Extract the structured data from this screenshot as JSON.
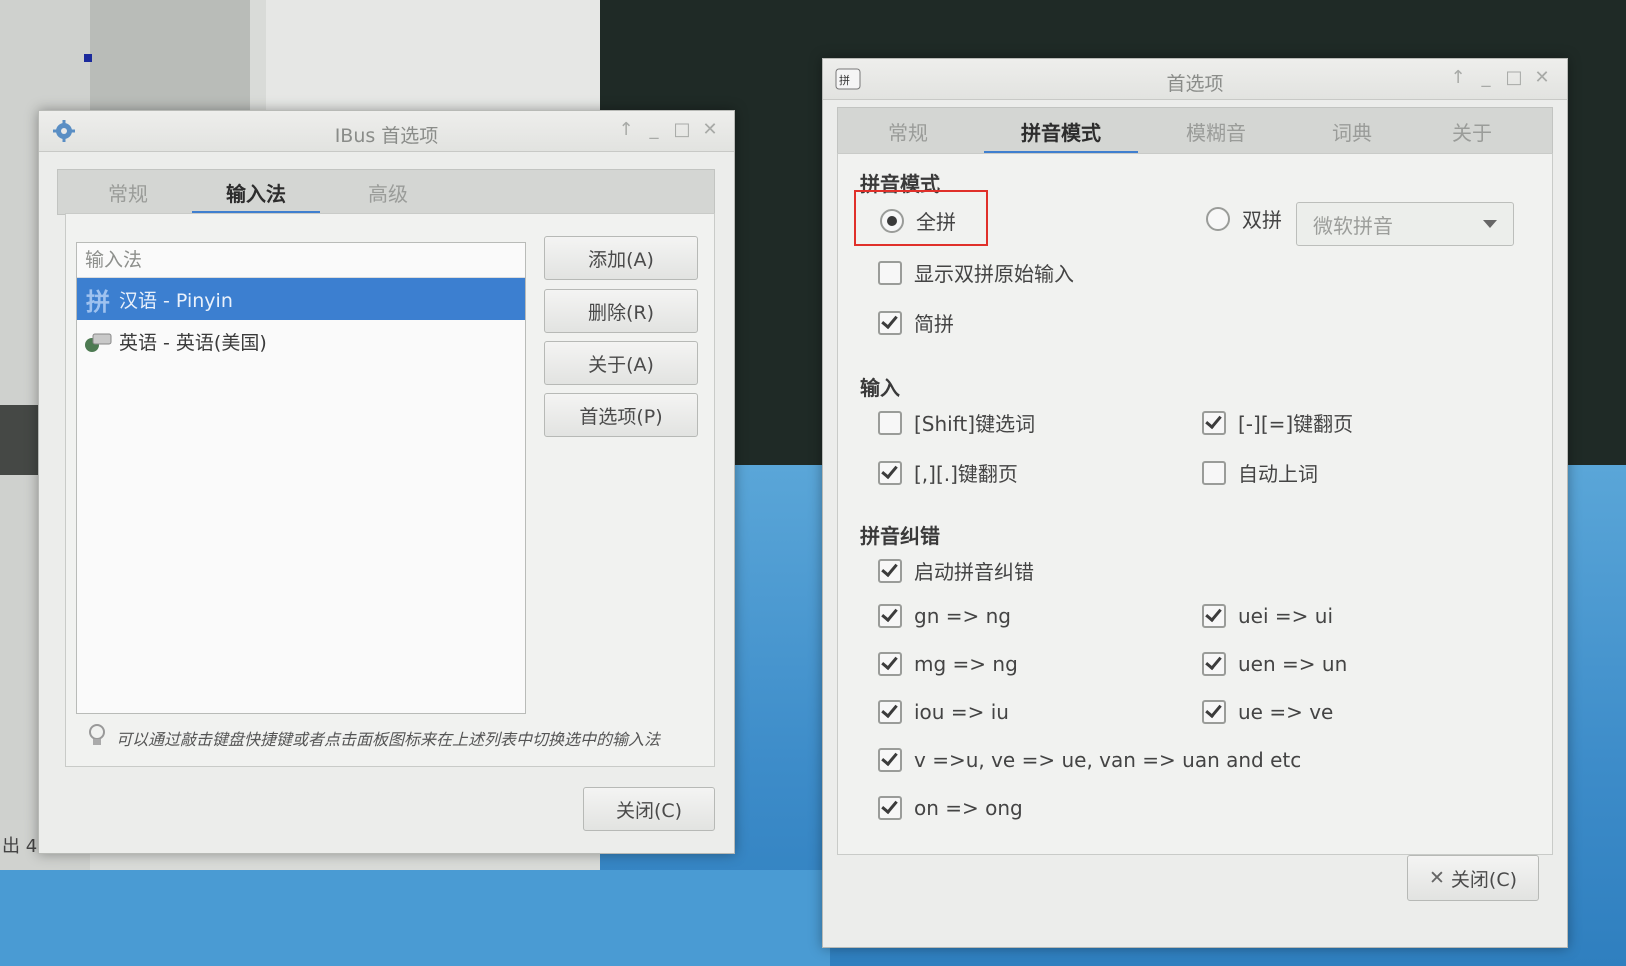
{
  "ibus_window": {
    "title": "IBus 首选项",
    "tabs": [
      {
        "label": "常规",
        "active": false
      },
      {
        "label": "输入法",
        "active": true
      },
      {
        "label": "高级",
        "active": false
      }
    ],
    "list_header": "输入法",
    "input_methods": [
      {
        "icon_text": "拼",
        "label": "汉语 - Pinyin",
        "selected": true
      },
      {
        "icon_text": "",
        "label": "英语 - 英语(美国)",
        "selected": false
      }
    ],
    "buttons": {
      "add": "添加(A)",
      "remove": "删除(R)",
      "about": "关于(A)",
      "preferences": "首选项(P)"
    },
    "hint": "可以通过敲击键盘快捷键或者点击面板图标来在上述列表中切换选中的输入法",
    "close": "关闭(C)"
  },
  "pinyin_window": {
    "title": "首选项",
    "tabs": [
      {
        "label": "常规",
        "active": false
      },
      {
        "label": "拼音模式",
        "active": true
      },
      {
        "label": "模糊音",
        "active": false
      },
      {
        "label": "词典",
        "active": false
      },
      {
        "label": "关于",
        "active": false
      }
    ],
    "section_mode": "拼音模式",
    "full_pinyin": {
      "label": "全拼",
      "selected": true
    },
    "double_pinyin": {
      "label": "双拼",
      "selected": false
    },
    "double_pinyin_scheme": "微软拼音",
    "show_raw_input": {
      "label": "显示双拼原始输入",
      "checked": false
    },
    "incomplete_pinyin": {
      "label": "简拼",
      "checked": true
    },
    "section_input": "输入",
    "shift_select": {
      "label": "[Shift]键选词",
      "checked": false
    },
    "minus_equal_page": {
      "label": "[-][=]键翻页",
      "checked": true
    },
    "comma_period_page": {
      "label": "[,][.]键翻页",
      "checked": true
    },
    "auto_commit": {
      "label": "自动上词",
      "checked": false
    },
    "section_correction": "拼音纠错",
    "enable_correction": {
      "label": "启动拼音纠错",
      "checked": true
    },
    "corrections": [
      {
        "label": "gn => ng",
        "checked": true
      },
      {
        "label": "uei => ui",
        "checked": true
      },
      {
        "label": "mg => ng",
        "checked": true
      },
      {
        "label": "uen => un",
        "checked": true
      },
      {
        "label": "iou => iu",
        "checked": true
      },
      {
        "label": "ue => ve",
        "checked": true
      },
      {
        "label": "v =>u, ve => ue, van => uan and etc",
        "checked": true
      },
      {
        "label": "on => ong",
        "checked": true
      }
    ],
    "close": "关闭(C)"
  },
  "desktop": {
    "taskbar_text": "出 4"
  }
}
